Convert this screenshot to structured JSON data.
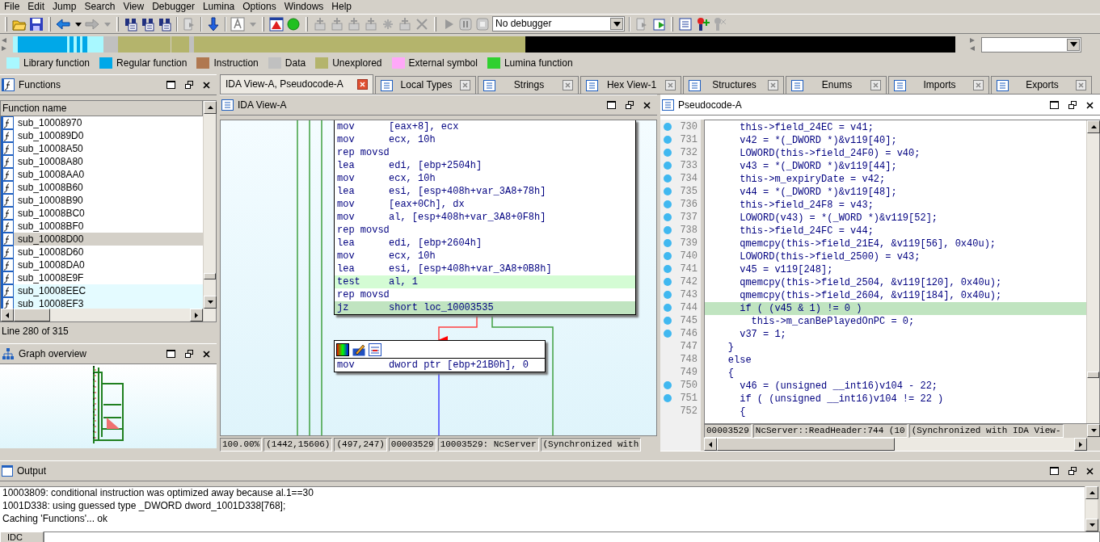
{
  "menu": [
    "File",
    "Edit",
    "Jump",
    "Search",
    "View",
    "Debugger",
    "Lumina",
    "Options",
    "Windows",
    "Help"
  ],
  "debugger_combo": {
    "value": "No debugger"
  },
  "legend": [
    {
      "label": "Library function",
      "color": "#a8f8ff"
    },
    {
      "label": "Regular function",
      "color": "#00a8e8"
    },
    {
      "label": "Instruction",
      "color": "#b07850"
    },
    {
      "label": "Data",
      "color": "#c0c0c0"
    },
    {
      "label": "Unexplored",
      "color": "#b4b46c"
    },
    {
      "label": "External symbol",
      "color": "#ffa8f8"
    },
    {
      "label": "Lumina function",
      "color": "#30d030"
    }
  ],
  "functions": {
    "title": "Functions",
    "column": "Function name",
    "status": "Line 280 of 315",
    "items": [
      {
        "name": "sub_10008970",
        "selected": false,
        "library": false
      },
      {
        "name": "sub_100089D0",
        "selected": false,
        "library": false
      },
      {
        "name": "sub_10008A50",
        "selected": false,
        "library": false
      },
      {
        "name": "sub_10008A80",
        "selected": false,
        "library": false
      },
      {
        "name": "sub_10008AA0",
        "selected": false,
        "library": false
      },
      {
        "name": "sub_10008B60",
        "selected": false,
        "library": false
      },
      {
        "name": "sub_10008B90",
        "selected": false,
        "library": false
      },
      {
        "name": "sub_10008BC0",
        "selected": false,
        "library": false
      },
      {
        "name": "sub_10008BF0",
        "selected": false,
        "library": false
      },
      {
        "name": "sub_10008D00",
        "selected": true,
        "library": false
      },
      {
        "name": "sub_10008D60",
        "selected": false,
        "library": false
      },
      {
        "name": "sub_10008DA0",
        "selected": false,
        "library": false
      },
      {
        "name": "sub_10008E9F",
        "selected": false,
        "library": false
      },
      {
        "name": "sub_10008EEC",
        "selected": false,
        "library": true
      },
      {
        "name": "sub_10008EF3",
        "selected": false,
        "library": true
      }
    ]
  },
  "graph_overview": {
    "title": "Graph overview"
  },
  "tabs": [
    {
      "label": "IDA View-A, Pseudocode-A",
      "selected": true
    },
    {
      "label": "Local Types",
      "selected": false
    },
    {
      "label": "Strings",
      "selected": false
    },
    {
      "label": "Hex View-1",
      "selected": false
    },
    {
      "label": "Structures",
      "selected": false
    },
    {
      "label": "Enums",
      "selected": false
    },
    {
      "label": "Imports",
      "selected": false
    },
    {
      "label": "Exports",
      "selected": false
    }
  ],
  "ida_view": {
    "title": "IDA View-A",
    "nodes": [
      {
        "lines": [
          {
            "mnemonic": "mov",
            "operands": "[eax+8], ecx",
            "highlighted": false,
            "current": false
          },
          {
            "mnemonic": "mov",
            "operands": "ecx, 10h",
            "highlighted": false,
            "current": false
          },
          {
            "mnemonic": "rep movsd",
            "highlighted": false,
            "current": false
          },
          {
            "mnemonic": "lea",
            "operands": "edi, [ebp+2504h]",
            "highlighted": false,
            "current": false
          },
          {
            "mnemonic": "mov",
            "operands": "ecx, 10h",
            "highlighted": false,
            "current": false
          },
          {
            "mnemonic": "lea",
            "operands": "esi, [esp+408h+var_3A8+78h]",
            "highlighted": false,
            "current": false
          },
          {
            "mnemonic": "mov",
            "operands": "[eax+0Ch], dx",
            "highlighted": false,
            "current": false
          },
          {
            "mnemonic": "mov",
            "operands": "al, [esp+408h+var_3A8+0F8h]",
            "highlighted": false,
            "current": false
          },
          {
            "mnemonic": "rep movsd",
            "highlighted": false,
            "current": false
          },
          {
            "mnemonic": "lea",
            "operands": "edi, [ebp+2604h]",
            "highlighted": false,
            "current": false
          },
          {
            "mnemonic": "mov",
            "operands": "ecx, 10h",
            "highlighted": false,
            "current": false
          },
          {
            "mnemonic": "lea",
            "operands": "esi, [esp+408h+var_3A8+0B8h]",
            "highlighted": false,
            "current": false
          },
          {
            "mnemonic": "test",
            "operands": "al, 1",
            "highlighted": true,
            "current": false
          },
          {
            "mnemonic": "rep movsd",
            "highlighted": false,
            "current": false
          },
          {
            "mnemonic": "jz",
            "operands": "short loc_10003535",
            "highlighted": false,
            "current": true
          }
        ]
      },
      {
        "lines": [
          {
            "mnemonic": "mov",
            "operands": "dword ptr [ebp+21B0h], 0",
            "highlighted": false,
            "current": false
          }
        ]
      }
    ],
    "status": [
      "100.00%",
      "(1442,15606)",
      "(497,247)",
      "00003529",
      "10003529: NcServer",
      "(Synchronized with"
    ]
  },
  "pseudocode": {
    "title": "Pseudocode-A",
    "lines": [
      {
        "number": "730",
        "dot": true,
        "highlighted": false,
        "code": "      this->field_24EC = v41;"
      },
      {
        "number": "731",
        "dot": true,
        "highlighted": false,
        "code": "      v42 = *(_DWORD *)&v119[40];"
      },
      {
        "number": "732",
        "dot": true,
        "highlighted": false,
        "code": "      LOWORD(this->field_24F0) = v40;"
      },
      {
        "number": "733",
        "dot": true,
        "highlighted": false,
        "code": "      v43 = *(_DWORD *)&v119[44];"
      },
      {
        "number": "734",
        "dot": true,
        "highlighted": false,
        "code": "      this->m_expiryDate = v42;"
      },
      {
        "number": "735",
        "dot": true,
        "highlighted": false,
        "code": "      v44 = *(_DWORD *)&v119[48];"
      },
      {
        "number": "736",
        "dot": true,
        "highlighted": false,
        "code": "      this->field_24F8 = v43;"
      },
      {
        "number": "737",
        "dot": true,
        "highlighted": false,
        "code": "      LOWORD(v43) = *(_WORD *)&v119[52];"
      },
      {
        "number": "738",
        "dot": true,
        "highlighted": false,
        "code": "      this->field_24FC = v44;"
      },
      {
        "number": "739",
        "dot": true,
        "highlighted": false,
        "code": "      qmemcpy(this->field_21E4, &v119[56], 0x40u);"
      },
      {
        "number": "740",
        "dot": true,
        "highlighted": false,
        "code": "      LOWORD(this->field_2500) = v43;"
      },
      {
        "number": "741",
        "dot": true,
        "highlighted": false,
        "code": "      v45 = v119[248];"
      },
      {
        "number": "742",
        "dot": true,
        "highlighted": false,
        "code": "      qmemcpy(this->field_2504, &v119[120], 0x40u);"
      },
      {
        "number": "743",
        "dot": true,
        "highlighted": false,
        "code": "      qmemcpy(this->field_2604, &v119[184], 0x40u);"
      },
      {
        "number": "744",
        "dot": true,
        "highlighted": true,
        "code": "      if ( (v45 & 1) != 0 )"
      },
      {
        "number": "745",
        "dot": true,
        "highlighted": false,
        "code": "        this->m_canBePlayedOnPC = 0;"
      },
      {
        "number": "746",
        "dot": true,
        "highlighted": false,
        "code": "      v37 = 1;"
      },
      {
        "number": "747",
        "dot": false,
        "highlighted": false,
        "code": "    }"
      },
      {
        "number": "748",
        "dot": false,
        "highlighted": false,
        "code": "    else"
      },
      {
        "number": "749",
        "dot": false,
        "highlighted": false,
        "code": "    {"
      },
      {
        "number": "750",
        "dot": true,
        "highlighted": false,
        "code": "      v46 = (unsigned __int16)v104 - 22;"
      },
      {
        "number": "751",
        "dot": true,
        "highlighted": false,
        "code": "      if ( (unsigned __int16)v104 != 22 )"
      },
      {
        "number": "752",
        "dot": false,
        "highlighted": false,
        "code": "      {"
      }
    ],
    "status": [
      "00003529",
      "NcServer::ReadHeader:744 (10",
      "(Synchronized with IDA View-"
    ]
  },
  "output": {
    "title": "Output",
    "lines": [
      "10003809: conditional instruction was optimized away because al.1==30",
      "1001D338: using guessed type _DWORD dword_1001D338[768];",
      "Caching 'Functions'... ok"
    ]
  },
  "command_bar": {
    "language": "IDC"
  }
}
